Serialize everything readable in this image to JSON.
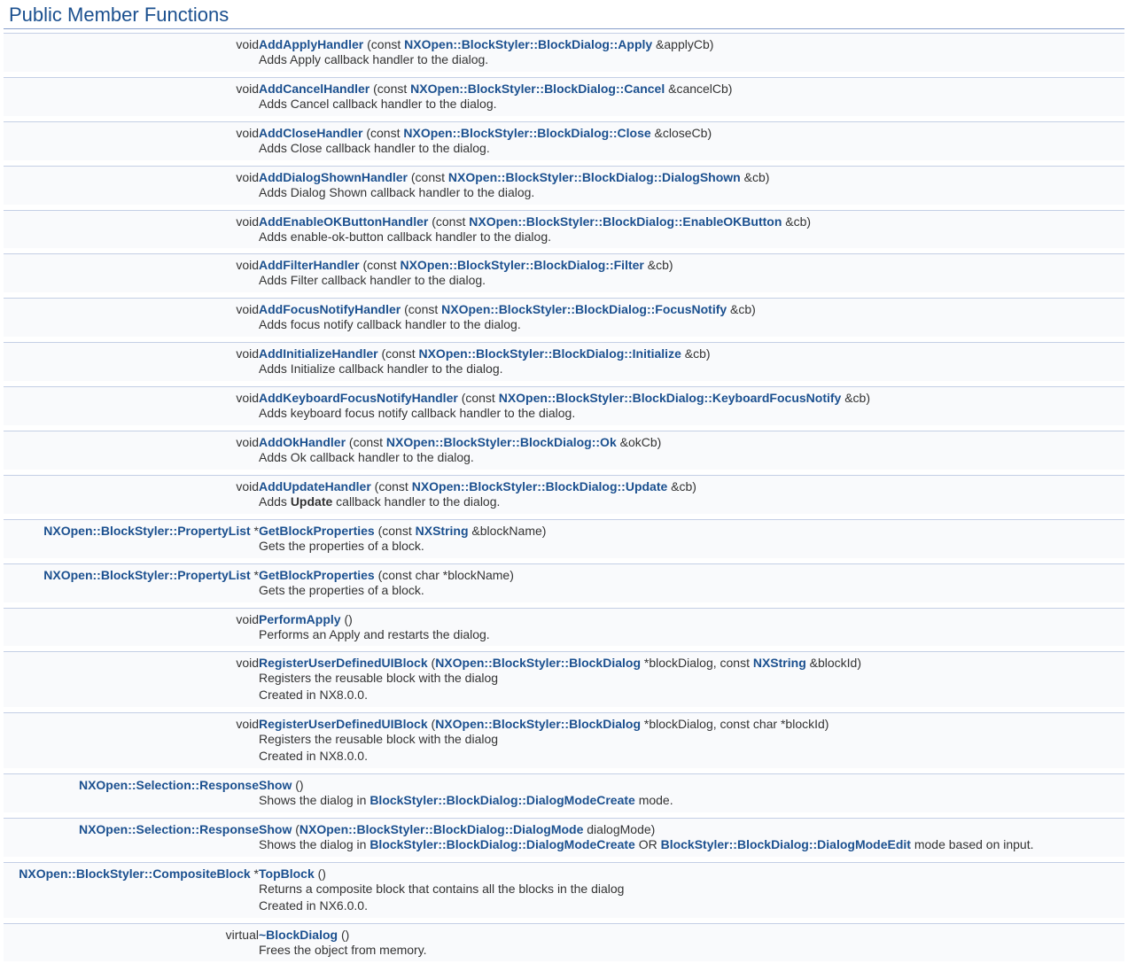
{
  "section_title": "Public Member Functions",
  "members": [
    {
      "ret_parts": [
        {
          "text": "void",
          "link": false
        }
      ],
      "sig_parts": [
        {
          "text": "AddApplyHandler",
          "link": true
        },
        {
          "text": " (const ",
          "link": false
        },
        {
          "text": "NXOpen::BlockStyler::BlockDialog::Apply",
          "link": true
        },
        {
          "text": " &applyCb)",
          "link": false
        }
      ],
      "desc_parts": [
        {
          "text": "Adds Apply callback handler to the dialog.",
          "link": false
        }
      ]
    },
    {
      "ret_parts": [
        {
          "text": "void",
          "link": false
        }
      ],
      "sig_parts": [
        {
          "text": "AddCancelHandler",
          "link": true
        },
        {
          "text": " (const ",
          "link": false
        },
        {
          "text": "NXOpen::BlockStyler::BlockDialog::Cancel",
          "link": true
        },
        {
          "text": " &cancelCb)",
          "link": false
        }
      ],
      "desc_parts": [
        {
          "text": "Adds Cancel callback handler to the dialog.",
          "link": false
        }
      ]
    },
    {
      "ret_parts": [
        {
          "text": "void",
          "link": false
        }
      ],
      "sig_parts": [
        {
          "text": "AddCloseHandler",
          "link": true
        },
        {
          "text": " (const ",
          "link": false
        },
        {
          "text": "NXOpen::BlockStyler::BlockDialog::Close",
          "link": true
        },
        {
          "text": " &closeCb)",
          "link": false
        }
      ],
      "desc_parts": [
        {
          "text": "Adds Close callback handler to the dialog.",
          "link": false
        }
      ]
    },
    {
      "ret_parts": [
        {
          "text": "void",
          "link": false
        }
      ],
      "sig_parts": [
        {
          "text": "AddDialogShownHandler",
          "link": true
        },
        {
          "text": " (const ",
          "link": false
        },
        {
          "text": "NXOpen::BlockStyler::BlockDialog::DialogShown",
          "link": true
        },
        {
          "text": " &cb)",
          "link": false
        }
      ],
      "desc_parts": [
        {
          "text": "Adds Dialog Shown callback handler to the dialog.",
          "link": false
        }
      ]
    },
    {
      "ret_parts": [
        {
          "text": "void",
          "link": false
        }
      ],
      "sig_parts": [
        {
          "text": "AddEnableOKButtonHandler",
          "link": true
        },
        {
          "text": " (const ",
          "link": false
        },
        {
          "text": "NXOpen::BlockStyler::BlockDialog::EnableOKButton",
          "link": true
        },
        {
          "text": " &cb)",
          "link": false
        }
      ],
      "desc_parts": [
        {
          "text": "Adds enable-ok-button callback handler to the dialog.",
          "link": false
        }
      ]
    },
    {
      "ret_parts": [
        {
          "text": "void",
          "link": false
        }
      ],
      "sig_parts": [
        {
          "text": "AddFilterHandler",
          "link": true
        },
        {
          "text": " (const ",
          "link": false
        },
        {
          "text": "NXOpen::BlockStyler::BlockDialog::Filter",
          "link": true
        },
        {
          "text": " &cb)",
          "link": false
        }
      ],
      "desc_parts": [
        {
          "text": "Adds Filter callback handler to the dialog.",
          "link": false
        }
      ]
    },
    {
      "ret_parts": [
        {
          "text": "void",
          "link": false
        }
      ],
      "sig_parts": [
        {
          "text": "AddFocusNotifyHandler",
          "link": true
        },
        {
          "text": " (const ",
          "link": false
        },
        {
          "text": "NXOpen::BlockStyler::BlockDialog::FocusNotify",
          "link": true
        },
        {
          "text": " &cb)",
          "link": false
        }
      ],
      "desc_parts": [
        {
          "text": "Adds focus notify callback handler to the dialog.",
          "link": false
        }
      ]
    },
    {
      "ret_parts": [
        {
          "text": "void",
          "link": false
        }
      ],
      "sig_parts": [
        {
          "text": "AddInitializeHandler",
          "link": true
        },
        {
          "text": " (const ",
          "link": false
        },
        {
          "text": "NXOpen::BlockStyler::BlockDialog::Initialize",
          "link": true
        },
        {
          "text": " &cb)",
          "link": false
        }
      ],
      "desc_parts": [
        {
          "text": "Adds Initialize callback handler to the dialog.",
          "link": false
        }
      ]
    },
    {
      "ret_parts": [
        {
          "text": "void",
          "link": false
        }
      ],
      "sig_parts": [
        {
          "text": "AddKeyboardFocusNotifyHandler",
          "link": true
        },
        {
          "text": " (const ",
          "link": false
        },
        {
          "text": "NXOpen::BlockStyler::BlockDialog::KeyboardFocusNotify",
          "link": true
        },
        {
          "text": " &cb)",
          "link": false
        }
      ],
      "desc_parts": [
        {
          "text": "Adds keyboard focus notify callback handler to the dialog.",
          "link": false
        }
      ]
    },
    {
      "ret_parts": [
        {
          "text": "void",
          "link": false
        }
      ],
      "sig_parts": [
        {
          "text": "AddOkHandler",
          "link": true
        },
        {
          "text": " (const ",
          "link": false
        },
        {
          "text": "NXOpen::BlockStyler::BlockDialog::Ok",
          "link": true
        },
        {
          "text": " &okCb)",
          "link": false
        }
      ],
      "desc_parts": [
        {
          "text": "Adds Ok callback handler to the dialog.",
          "link": false
        }
      ]
    },
    {
      "ret_parts": [
        {
          "text": "void",
          "link": false
        }
      ],
      "sig_parts": [
        {
          "text": "AddUpdateHandler",
          "link": true
        },
        {
          "text": " (const ",
          "link": false
        },
        {
          "text": "NXOpen::BlockStyler::BlockDialog::Update",
          "link": true
        },
        {
          "text": " &cb)",
          "link": false
        }
      ],
      "desc_parts": [
        {
          "text": "Adds ",
          "link": false
        },
        {
          "text": "Update",
          "link": false,
          "bold": true
        },
        {
          "text": " callback handler to the dialog.",
          "link": false
        }
      ]
    },
    {
      "ret_parts": [
        {
          "text": "NXOpen::BlockStyler::PropertyList",
          "link": true
        },
        {
          "text": " *",
          "link": false
        }
      ],
      "sig_parts": [
        {
          "text": "GetBlockProperties",
          "link": true
        },
        {
          "text": " (const ",
          "link": false
        },
        {
          "text": "NXString",
          "link": true
        },
        {
          "text": " &blockName)",
          "link": false
        }
      ],
      "desc_parts": [
        {
          "text": "Gets the properties of a block.",
          "link": false
        }
      ]
    },
    {
      "ret_parts": [
        {
          "text": "NXOpen::BlockStyler::PropertyList",
          "link": true
        },
        {
          "text": " *",
          "link": false
        }
      ],
      "sig_parts": [
        {
          "text": "GetBlockProperties",
          "link": true
        },
        {
          "text": " (const char *blockName)",
          "link": false
        }
      ],
      "desc_parts": [
        {
          "text": "Gets the properties of a block.",
          "link": false
        }
      ]
    },
    {
      "ret_parts": [
        {
          "text": "void",
          "link": false
        }
      ],
      "sig_parts": [
        {
          "text": "PerformApply",
          "link": true
        },
        {
          "text": " ()",
          "link": false
        }
      ],
      "desc_parts": [
        {
          "text": "Performs an Apply and restarts the dialog.",
          "link": false
        }
      ]
    },
    {
      "ret_parts": [
        {
          "text": "void",
          "link": false
        }
      ],
      "sig_parts": [
        {
          "text": "RegisterUserDefinedUIBlock",
          "link": true
        },
        {
          "text": " (",
          "link": false
        },
        {
          "text": "NXOpen::BlockStyler::BlockDialog",
          "link": true
        },
        {
          "text": " *blockDialog, const ",
          "link": false
        },
        {
          "text": "NXString",
          "link": true
        },
        {
          "text": " &blockId)",
          "link": false
        }
      ],
      "desc_parts": [
        {
          "text": "Registers the reusable block with the dialog",
          "link": false,
          "br": true
        },
        {
          "text": "Created in NX8.0.0.",
          "link": false
        }
      ]
    },
    {
      "ret_parts": [
        {
          "text": "void",
          "link": false
        }
      ],
      "sig_parts": [
        {
          "text": "RegisterUserDefinedUIBlock",
          "link": true
        },
        {
          "text": " (",
          "link": false
        },
        {
          "text": "NXOpen::BlockStyler::BlockDialog",
          "link": true
        },
        {
          "text": " *blockDialog, const char *blockId)",
          "link": false
        }
      ],
      "desc_parts": [
        {
          "text": "Registers the reusable block with the dialog",
          "link": false,
          "br": true
        },
        {
          "text": "Created in NX8.0.0.",
          "link": false
        }
      ]
    },
    {
      "ret_parts": [
        {
          "text": "NXOpen::Selection::Response",
          "link": true
        }
      ],
      "sig_parts": [
        {
          "text": "Show",
          "link": true
        },
        {
          "text": " ()",
          "link": false
        }
      ],
      "desc_parts": [
        {
          "text": "Shows the dialog in ",
          "link": false
        },
        {
          "text": "BlockStyler::BlockDialog::DialogModeCreate",
          "link": true
        },
        {
          "text": " mode.",
          "link": false
        }
      ]
    },
    {
      "ret_parts": [
        {
          "text": "NXOpen::Selection::Response",
          "link": true
        }
      ],
      "sig_parts": [
        {
          "text": "Show",
          "link": true
        },
        {
          "text": " (",
          "link": false
        },
        {
          "text": "NXOpen::BlockStyler::BlockDialog::DialogMode",
          "link": true
        },
        {
          "text": " dialogMode)",
          "link": false
        }
      ],
      "desc_parts": [
        {
          "text": "Shows the dialog in ",
          "link": false
        },
        {
          "text": "BlockStyler::BlockDialog::DialogModeCreate",
          "link": true
        },
        {
          "text": " OR ",
          "link": false
        },
        {
          "text": "BlockStyler::BlockDialog::DialogModeEdit",
          "link": true
        },
        {
          "text": " mode based on input.",
          "link": false
        }
      ]
    },
    {
      "ret_parts": [
        {
          "text": "NXOpen::BlockStyler::CompositeBlock",
          "link": true
        },
        {
          "text": " *",
          "link": false
        }
      ],
      "sig_parts": [
        {
          "text": "TopBlock",
          "link": true
        },
        {
          "text": " ()",
          "link": false
        }
      ],
      "desc_parts": [
        {
          "text": "Returns a composite block that contains all the blocks in the dialog",
          "link": false,
          "br": true
        },
        {
          "text": "Created in NX6.0.0.",
          "link": false
        }
      ]
    },
    {
      "ret_parts": [
        {
          "text": "virtual",
          "link": false
        }
      ],
      "sig_parts": [
        {
          "text": "~BlockDialog",
          "link": true
        },
        {
          "text": " ()",
          "link": false
        }
      ],
      "desc_parts": [
        {
          "text": "Frees the object from memory.",
          "link": false
        }
      ]
    }
  ]
}
